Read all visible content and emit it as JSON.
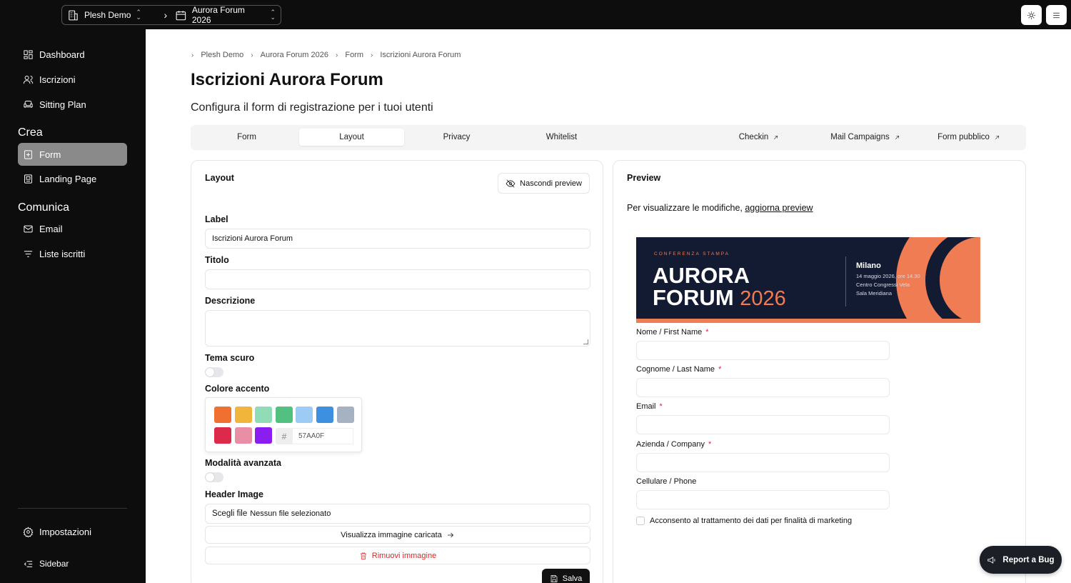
{
  "topbar": {
    "workspace": "Plesh Demo",
    "event": "Aurora Forum 2026"
  },
  "sidebar": {
    "items": [
      {
        "label": "Dashboard",
        "icon": "grid-icon"
      },
      {
        "label": "Iscrizioni",
        "icon": "users-icon"
      },
      {
        "label": "Sitting Plan",
        "icon": "sofa-icon"
      }
    ],
    "section_crea": "Crea",
    "crea_items": [
      {
        "label": "Form",
        "icon": "form-icon",
        "active": true
      },
      {
        "label": "Landing Page",
        "icon": "page-icon"
      }
    ],
    "section_comunica": "Comunica",
    "comunica_items": [
      {
        "label": "Email",
        "icon": "mail-icon"
      },
      {
        "label": "Liste iscritti",
        "icon": "filter-list-icon"
      }
    ],
    "settings": "Impostazioni",
    "sidebar_toggle": "Sidebar"
  },
  "breadcrumb": [
    "Plesh Demo",
    "Aurora Forum 2026",
    "Form",
    "Iscrizioni Aurora Forum"
  ],
  "page": {
    "title": "Iscrizioni Aurora Forum",
    "subtitle": "Configura il form di registrazione per i tuoi utenti"
  },
  "tabs": [
    {
      "label": "Form"
    },
    {
      "label": "Layout",
      "active": true
    },
    {
      "label": "Privacy"
    },
    {
      "label": "Whitelist"
    },
    {
      "label": "Checkin",
      "external": true
    },
    {
      "label": "Mail Campaigns",
      "external": true
    },
    {
      "label": "Form pubblico",
      "external": true
    }
  ],
  "layout_panel": {
    "title": "Layout",
    "hide_preview": "Nascondi preview",
    "label_label": "Label",
    "label_value": "Iscrizioni Aurora Forum",
    "titolo_label": "Titolo",
    "titolo_value": "",
    "descrizione_label": "Descrizione",
    "tema_scuro_label": "Tema scuro",
    "tema_scuro_on": false,
    "colore_label": "Colore accento",
    "swatches": [
      "#f07031",
      "#f2b53c",
      "#8fdcb6",
      "#52c07f",
      "#9ccbf5",
      "#3d8fe0",
      "#a6b2c2",
      "#dd2a4a",
      "#e88fa6",
      "#8a1ef0"
    ],
    "hex_value": "57AA0F",
    "avanzata_label": "Modalità avanzata",
    "avanzata_on": false,
    "header_image_label": "Header Image",
    "choose_file": "Scegli file",
    "no_file": "Nessun file selezionato",
    "view_image": "Visualizza immagine caricata",
    "remove_image": "Rimuovi immagine",
    "save": "Salva"
  },
  "preview_panel": {
    "title": "Preview",
    "note_prefix": "Per visualizzare le modifiche, ",
    "note_link": "aggiorna preview",
    "banner": {
      "kicker": "CONFERENZA STAMPA",
      "line1": "AURORA",
      "line2": "FORUM",
      "year": "2026",
      "city": "Milano",
      "date": "14 maggio 2026, ore 14.30",
      "venue": "Centro Congressi Vela",
      "room": "Sala Meridiana"
    },
    "fields": [
      {
        "label": "Nome / First Name",
        "required": "*"
      },
      {
        "label": "Cognome / Last Name",
        "required": "*"
      },
      {
        "label": "Email",
        "required": "*"
      },
      {
        "label": "Azienda / Company",
        "required": "*"
      },
      {
        "label": "Cellulare / Phone",
        "required": ""
      }
    ],
    "consent": "Acconsento al trattamento dei dati per finalità di marketing"
  },
  "report_bug": "Report a Bug"
}
